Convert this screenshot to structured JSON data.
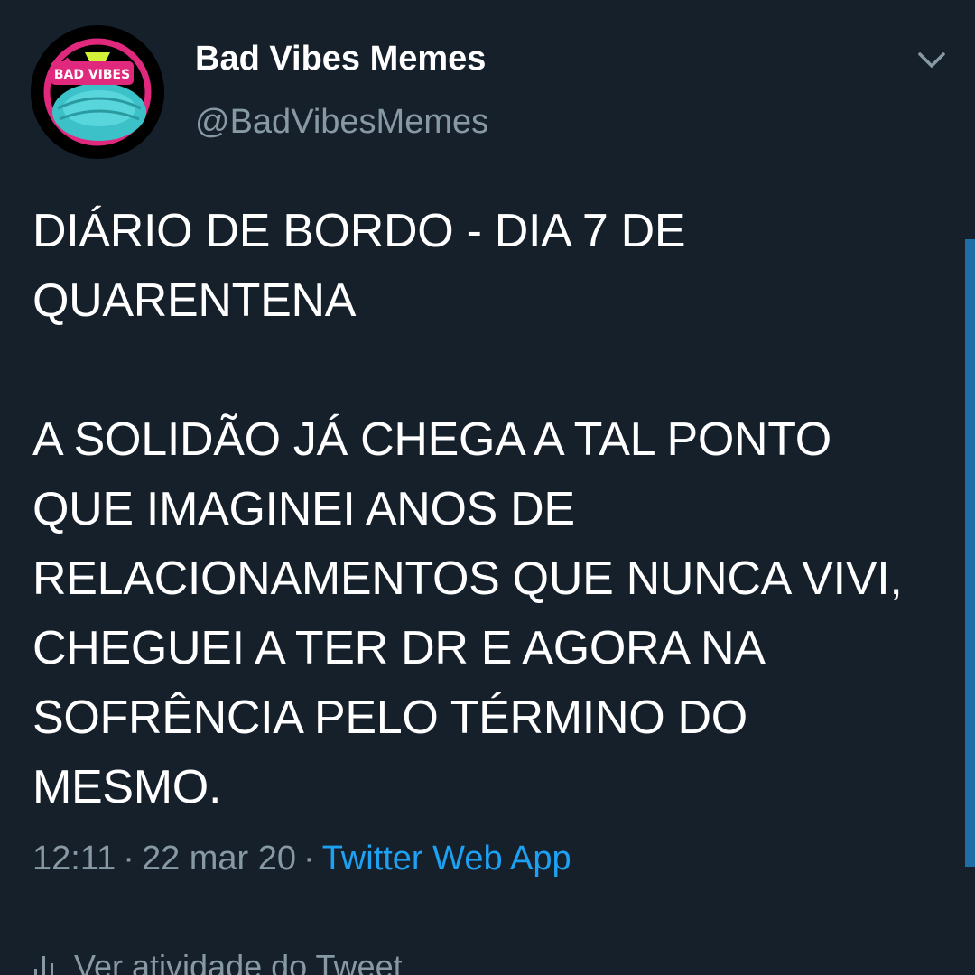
{
  "tweet": {
    "author": {
      "display_name": "Bad Vibes Memes",
      "handle": "@BadVibesMemes",
      "avatar_text": "BAD VIBES",
      "avatar_icon": "bad-vibes-logo-icon"
    },
    "menu_icon": "chevron-down-icon",
    "text": "DIÁRIO DE BORDO - DIA 7 DE QUARENTENA\n\nA SOLIDÃO JÁ CHEGA A TAL PONTO QUE IMAGINEI ANOS DE RELACIONAMENTOS QUE NUNCA VIVI, CHEGUEI A TER DR E AGORA NA SOFRÊNCIA PELO TÉRMINO DO MESMO.",
    "time": "12:11",
    "date": "22 mar 20",
    "separator": "·",
    "source": "Twitter Web App",
    "activity_label": "Ver atividade do Tweet",
    "activity_icon": "bar-chart-icon"
  },
  "colors": {
    "background": "#15202b",
    "text_primary": "#ffffff",
    "text_secondary": "#8899a6",
    "accent": "#1da1f2",
    "divider": "#38444d"
  }
}
